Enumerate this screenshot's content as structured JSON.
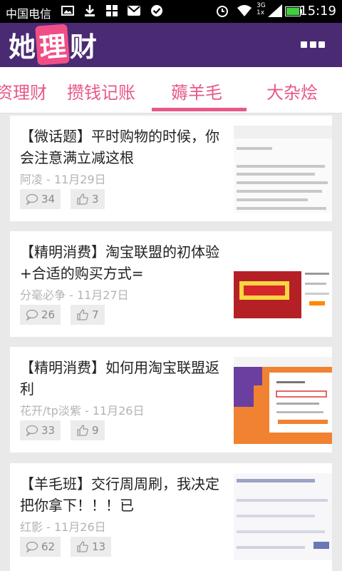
{
  "status_bar": {
    "carrier": "中国电信",
    "time": "15:19",
    "network_label_top": "3G",
    "network_label_bottom": "1x"
  },
  "app": {
    "logo_part1": "她",
    "logo_part2": "理",
    "logo_part3": "财"
  },
  "tabs": [
    {
      "label": "资理财"
    },
    {
      "label": "攒钱记账"
    },
    {
      "label": "薅羊毛",
      "active": true
    },
    {
      "label": "大杂烩"
    }
  ],
  "articles": [
    {
      "title": "【微话题】平时购物的时候，你会注意满立减这根",
      "meta": "阿凌 - 11月29日",
      "comments": "34",
      "likes": "3"
    },
    {
      "title": "【精明消费】淘宝联盟的初体验+合适的购买方式=",
      "meta": "分毫必争 - 11月27日",
      "comments": "26",
      "likes": "7"
    },
    {
      "title": "【精明消费】如何用淘宝联盟返利",
      "meta": "花开/tp淡紫 - 11月26日",
      "comments": "33",
      "likes": "9"
    },
    {
      "title": "【羊毛班】交行周周刷，我决定把你拿下！！！已",
      "meta": "红影 - 11月26日",
      "comments": "62",
      "likes": "13"
    }
  ],
  "colors": {
    "header": "#4a2a73",
    "accent": "#e85889",
    "background": "#e9e9e9"
  }
}
